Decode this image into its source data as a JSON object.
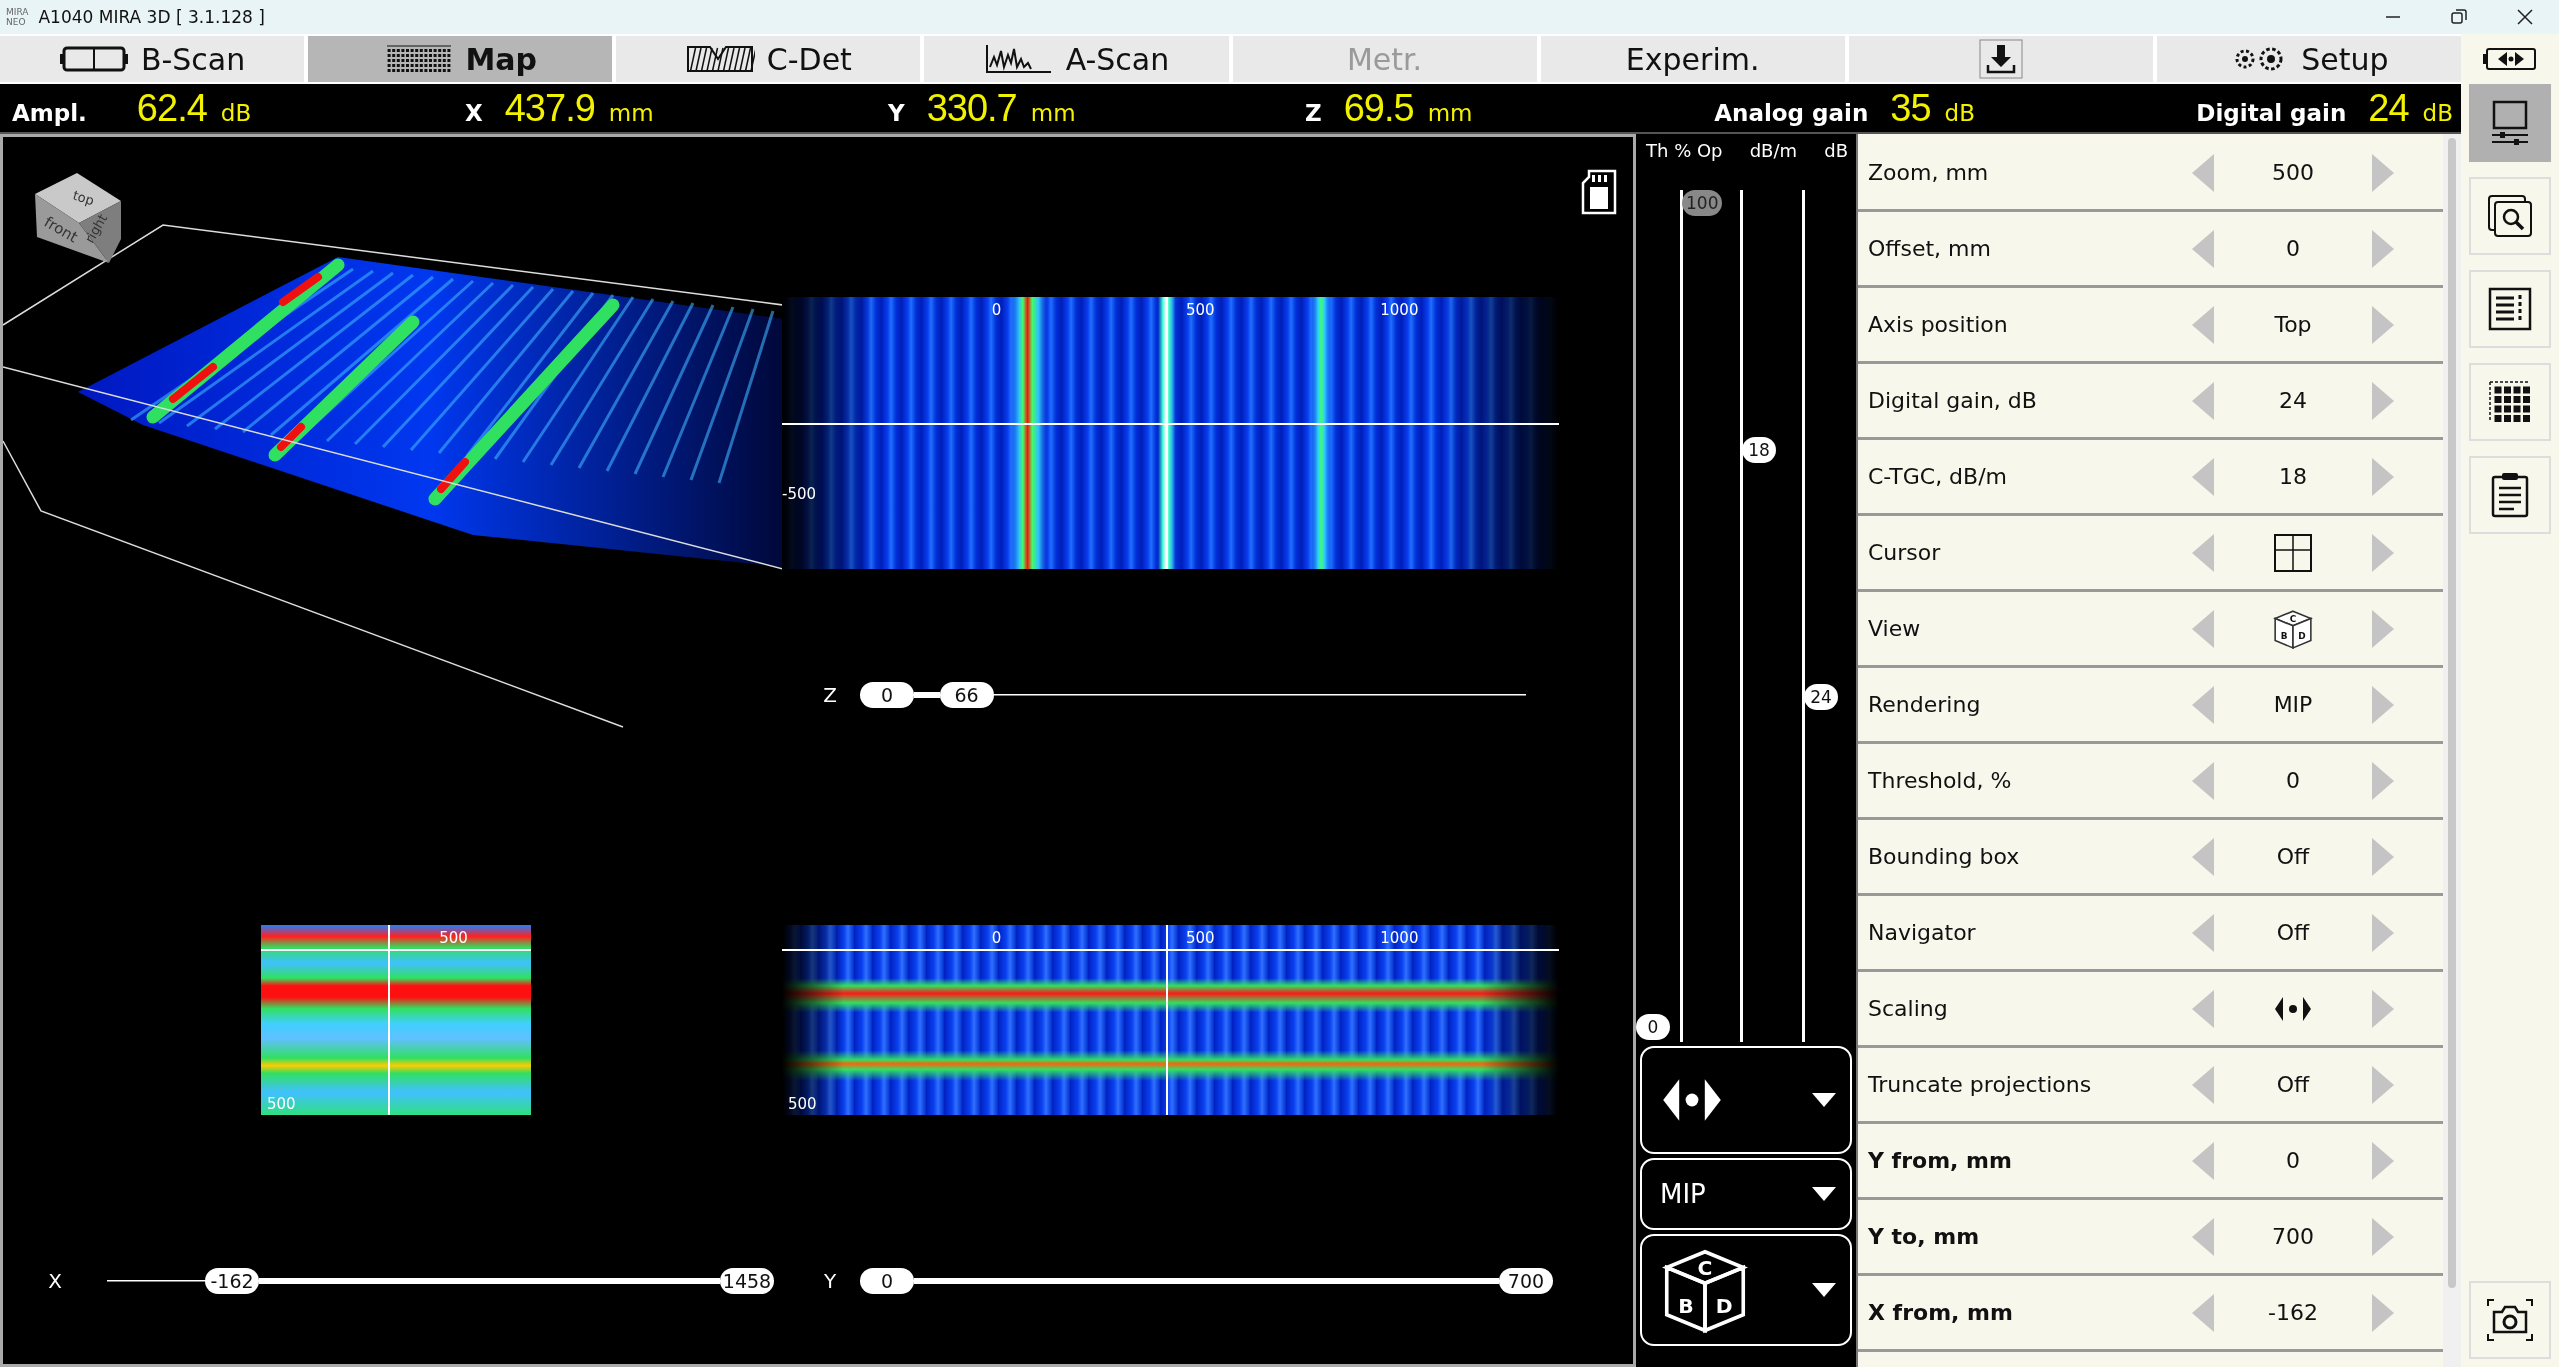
{
  "window": {
    "title": "A1040 MIRA 3D [ 3.1.128 ]",
    "logo": [
      "MIRA",
      "NEO"
    ]
  },
  "tabs": [
    {
      "label": "B-Scan",
      "selected": false,
      "disabled": false
    },
    {
      "label": "Map",
      "selected": true,
      "disabled": false
    },
    {
      "label": "C-Det",
      "selected": false,
      "disabled": false
    },
    {
      "label": "A-Scan",
      "selected": false,
      "disabled": false
    },
    {
      "label": "Metr.",
      "selected": false,
      "disabled": true
    },
    {
      "label": "Experim.",
      "selected": false,
      "disabled": false
    },
    {
      "selected": false,
      "disabled": false
    },
    {
      "label": "Setup",
      "selected": false,
      "disabled": false
    }
  ],
  "readouts": [
    {
      "label": "Ampl.",
      "value": "62.4",
      "unit": "dB"
    },
    {
      "label": "X",
      "value": "437.9",
      "unit": "mm"
    },
    {
      "label": "Y",
      "value": "330.7",
      "unit": "mm"
    },
    {
      "label": "Z",
      "value": "69.5",
      "unit": "mm"
    },
    {
      "label": "Analog gain",
      "value": "35",
      "unit": "dB"
    },
    {
      "label": "Digital gain",
      "value": "24",
      "unit": "dB"
    }
  ],
  "viewer": {
    "cube_faces": [
      "top",
      "front",
      "right"
    ],
    "c_scan": {
      "x_ticks": [
        "0",
        "500",
        "1000"
      ],
      "y_tick": "-500"
    },
    "d_scan": {
      "x_ticks": [
        "500"
      ],
      "y_tick": "500"
    },
    "b_scan": {
      "x_ticks": [
        "0",
        "500",
        "1000"
      ],
      "y_tick": "500"
    },
    "sliders": [
      {
        "axis": "Z",
        "thumbs": [
          {
            "value": "0",
            "level": 0
          },
          {
            "value": "66",
            "level": 0.13
          }
        ]
      },
      {
        "axis": "X",
        "thumbs": [
          {
            "value": "-162",
            "level": 0.16
          },
          {
            "value": "1458",
            "level": 1
          }
        ]
      },
      {
        "axis": "Y",
        "thumbs": [
          {
            "value": "0",
            "level": 0
          },
          {
            "value": "700",
            "level": 1
          }
        ]
      }
    ]
  },
  "gain_sliders": {
    "tracks": [
      {
        "header": "Th % Op",
        "thumbs": [
          {
            "value": "100",
            "level": 1,
            "dimmed": true
          },
          {
            "value": "0",
            "level": 0,
            "dimmed": false
          }
        ]
      },
      {
        "header": "dB/m",
        "thumbs": [
          {
            "value": "18",
            "level": 0.7,
            "dimmed": false
          }
        ]
      },
      {
        "header": "dB",
        "thumbs": [
          {
            "value": "24",
            "level": 0.4,
            "dimmed": false
          }
        ]
      }
    ]
  },
  "dropdowns": [
    {
      "kind": "scaling"
    },
    {
      "kind": "text",
      "value": "MIP"
    },
    {
      "kind": "cube",
      "letters": [
        "C",
        "B",
        "D"
      ]
    }
  ],
  "settings": [
    {
      "label": "Zoom, mm",
      "kind": "text",
      "value": "500",
      "bold": false
    },
    {
      "label": "Offset, mm",
      "kind": "text",
      "value": "0",
      "bold": false
    },
    {
      "label": "Axis position",
      "kind": "text",
      "value": "Top",
      "bold": false
    },
    {
      "label": "Digital gain, dB",
      "kind": "text",
      "value": "24",
      "bold": false
    },
    {
      "label": "C-TGC, dB/m",
      "kind": "text",
      "value": "18",
      "bold": false
    },
    {
      "label": "Cursor",
      "kind": "cursor",
      "bold": false
    },
    {
      "label": "View",
      "kind": "cube",
      "letters": [
        "C",
        "B",
        "D"
      ],
      "bold": false
    },
    {
      "label": "Rendering",
      "kind": "text",
      "value": "MIP",
      "bold": false
    },
    {
      "label": "Threshold, %",
      "kind": "text",
      "value": "0",
      "bold": false
    },
    {
      "label": "Bounding box",
      "kind": "text",
      "value": "Off",
      "bold": false
    },
    {
      "label": "Navigator",
      "kind": "text",
      "value": "Off",
      "bold": false
    },
    {
      "label": "Scaling",
      "kind": "scaling",
      "bold": false
    },
    {
      "label": "Truncate projections",
      "kind": "text",
      "value": "Off",
      "bold": false
    },
    {
      "label": "Y from, mm",
      "kind": "text",
      "value": "0",
      "bold": true
    },
    {
      "label": "Y to, mm",
      "kind": "text",
      "value": "700",
      "bold": true
    },
    {
      "label": "X from, mm",
      "kind": "text",
      "value": "-162",
      "bold": true
    }
  ],
  "sidebar": {
    "items": [
      {
        "selected": true
      },
      {
        "selected": false
      },
      {
        "selected": false
      },
      {
        "selected": false
      },
      {
        "selected": false
      }
    ]
  }
}
